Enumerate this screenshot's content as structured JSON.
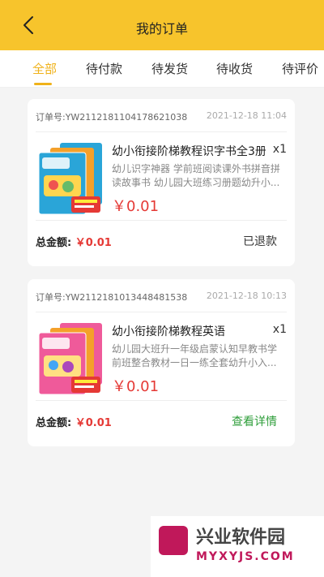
{
  "header": {
    "title": "我的订单"
  },
  "tabs": [
    {
      "label": "全部"
    },
    {
      "label": "待付款"
    },
    {
      "label": "待发货"
    },
    {
      "label": "待收货"
    },
    {
      "label": "待评价"
    }
  ],
  "orders": [
    {
      "order_no": "订单号:YW2112181104178621038",
      "time": "2021-12-18 11:04",
      "product": {
        "name": "幼小衔接阶梯教程识字书全3册",
        "qty": "x1",
        "desc": "幼儿识字神器 学前班阅读课外书拼音拼读故事书 幼儿园大班练习册题幼升小...",
        "price": "￥0.01",
        "cover_color": "#2aa5d8"
      },
      "total_label": "总金额:",
      "total_value": "￥0.01",
      "status": "已退款"
    },
    {
      "order_no": "订单号:YW2112181013448481538",
      "time": "2021-12-18 10:13",
      "product": {
        "name": "幼小衔接阶梯教程英语",
        "qty": "x1",
        "desc": "幼儿园大班升一年级启蒙认知早教书学前班整合教材一日一练全套幼升小入...",
        "price": "￥0.01",
        "cover_color": "#ef5a9a"
      },
      "total_label": "总金额:",
      "total_value": "￥0.01",
      "status": "查看详情"
    }
  ],
  "colors": {
    "accent": "#f7c42c",
    "tab_active": "#f0b21a",
    "price": "#e53935",
    "link": "#2e9e3a"
  },
  "watermark": {
    "text": "兴业软件园",
    "sub": "MYXYJS.COM"
  }
}
